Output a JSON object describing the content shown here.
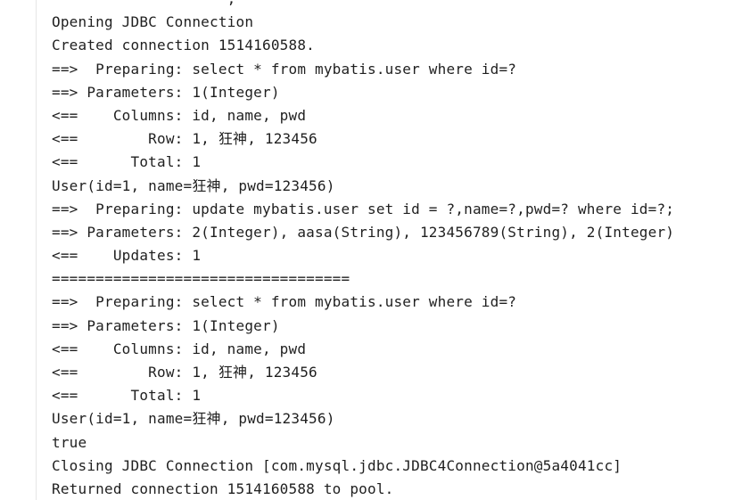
{
  "console": {
    "lines": [
      "                    ,   ",
      "Opening JDBC Connection",
      "Created connection 1514160588.",
      "==>  Preparing: select * from mybatis.user where id=?",
      "==> Parameters: 1(Integer)",
      "<==    Columns: id, name, pwd",
      "<==        Row: 1, 狂神, 123456",
      "<==      Total: 1",
      "User(id=1, name=狂神, pwd=123456)",
      "==>  Preparing: update mybatis.user set id = ?,name=?,pwd=? where id=?;",
      "==> Parameters: 2(Integer), aasa(String), 123456789(String), 2(Integer)",
      "<==    Updates: 1",
      "==================================",
      "==>  Preparing: select * from mybatis.user where id=?",
      "==> Parameters: 1(Integer)",
      "<==    Columns: id, name, pwd",
      "<==        Row: 1, 狂神, 123456",
      "<==      Total: 1",
      "User(id=1, name=狂神, pwd=123456)",
      "true",
      "Closing JDBC Connection [com.mysql.jdbc.JDBC4Connection@5a4041cc]",
      "Returned connection 1514160588 to pool."
    ]
  }
}
